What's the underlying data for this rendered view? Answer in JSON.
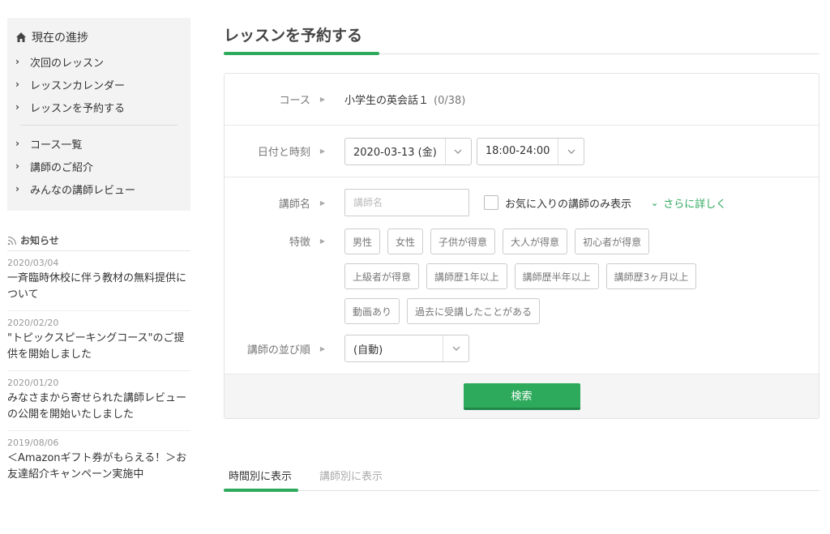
{
  "sidebar": {
    "progress_title": "現在の進捗",
    "links_top": [
      {
        "label": "次回のレッスン"
      },
      {
        "label": "レッスンカレンダー"
      },
      {
        "label": "レッスンを予約する"
      }
    ],
    "links_bottom": [
      {
        "label": "コース一覧"
      },
      {
        "label": "講師のご紹介"
      },
      {
        "label": "みんなの講師レビュー"
      }
    ]
  },
  "news": {
    "title": "お知らせ",
    "items": [
      {
        "date": "2020/03/04",
        "text": "一斉臨時休校に伴う教材の無料提供について"
      },
      {
        "date": "2020/02/20",
        "text": "\"トピックスピーキングコース\"のご提供を開始しました"
      },
      {
        "date": "2020/01/20",
        "text": "みなさまから寄せられた講師レビューの公開を開始いたしました"
      },
      {
        "date": "2019/08/06",
        "text": "＜Amazonギフト券がもらえる！＞お友達紹介キャンペーン実施中"
      }
    ]
  },
  "main": {
    "title": "レッスンを予約する",
    "course": {
      "label": "コース",
      "value": "小学生の英会話１",
      "count": "(0/38)"
    },
    "datetime": {
      "label": "日付と時刻",
      "date": "2020-03-13 (金)",
      "time": "18:00-24:00"
    },
    "teacher": {
      "label": "講師名",
      "placeholder": "講師名",
      "favorites_label": "お気に入りの講師のみ表示",
      "more_label": "さらに詳しく"
    },
    "features": {
      "label": "特徴",
      "tags": [
        {
          "label": "男性"
        },
        {
          "label": "女性"
        },
        {
          "label": "子供が得意"
        },
        {
          "label": "大人が得意"
        },
        {
          "label": "初心者が得意"
        },
        {
          "label": "上級者が得意"
        },
        {
          "label": "講師歴1年以上"
        },
        {
          "label": "講師歴半年以上"
        },
        {
          "label": "講師歴3ヶ月以上"
        },
        {
          "label": "動画あり"
        },
        {
          "label": "過去に受講したことがある"
        }
      ]
    },
    "order": {
      "label": "講師の並び順",
      "value": "(自動)"
    },
    "search_label": "検索"
  },
  "tabs": [
    {
      "label": "時間別に表示"
    },
    {
      "label": "講師別に表示"
    }
  ],
  "colors": {
    "accent": "#2eaa5c",
    "accent_dark": "#22874a",
    "sidebar_bg": "#f3f3f3"
  }
}
